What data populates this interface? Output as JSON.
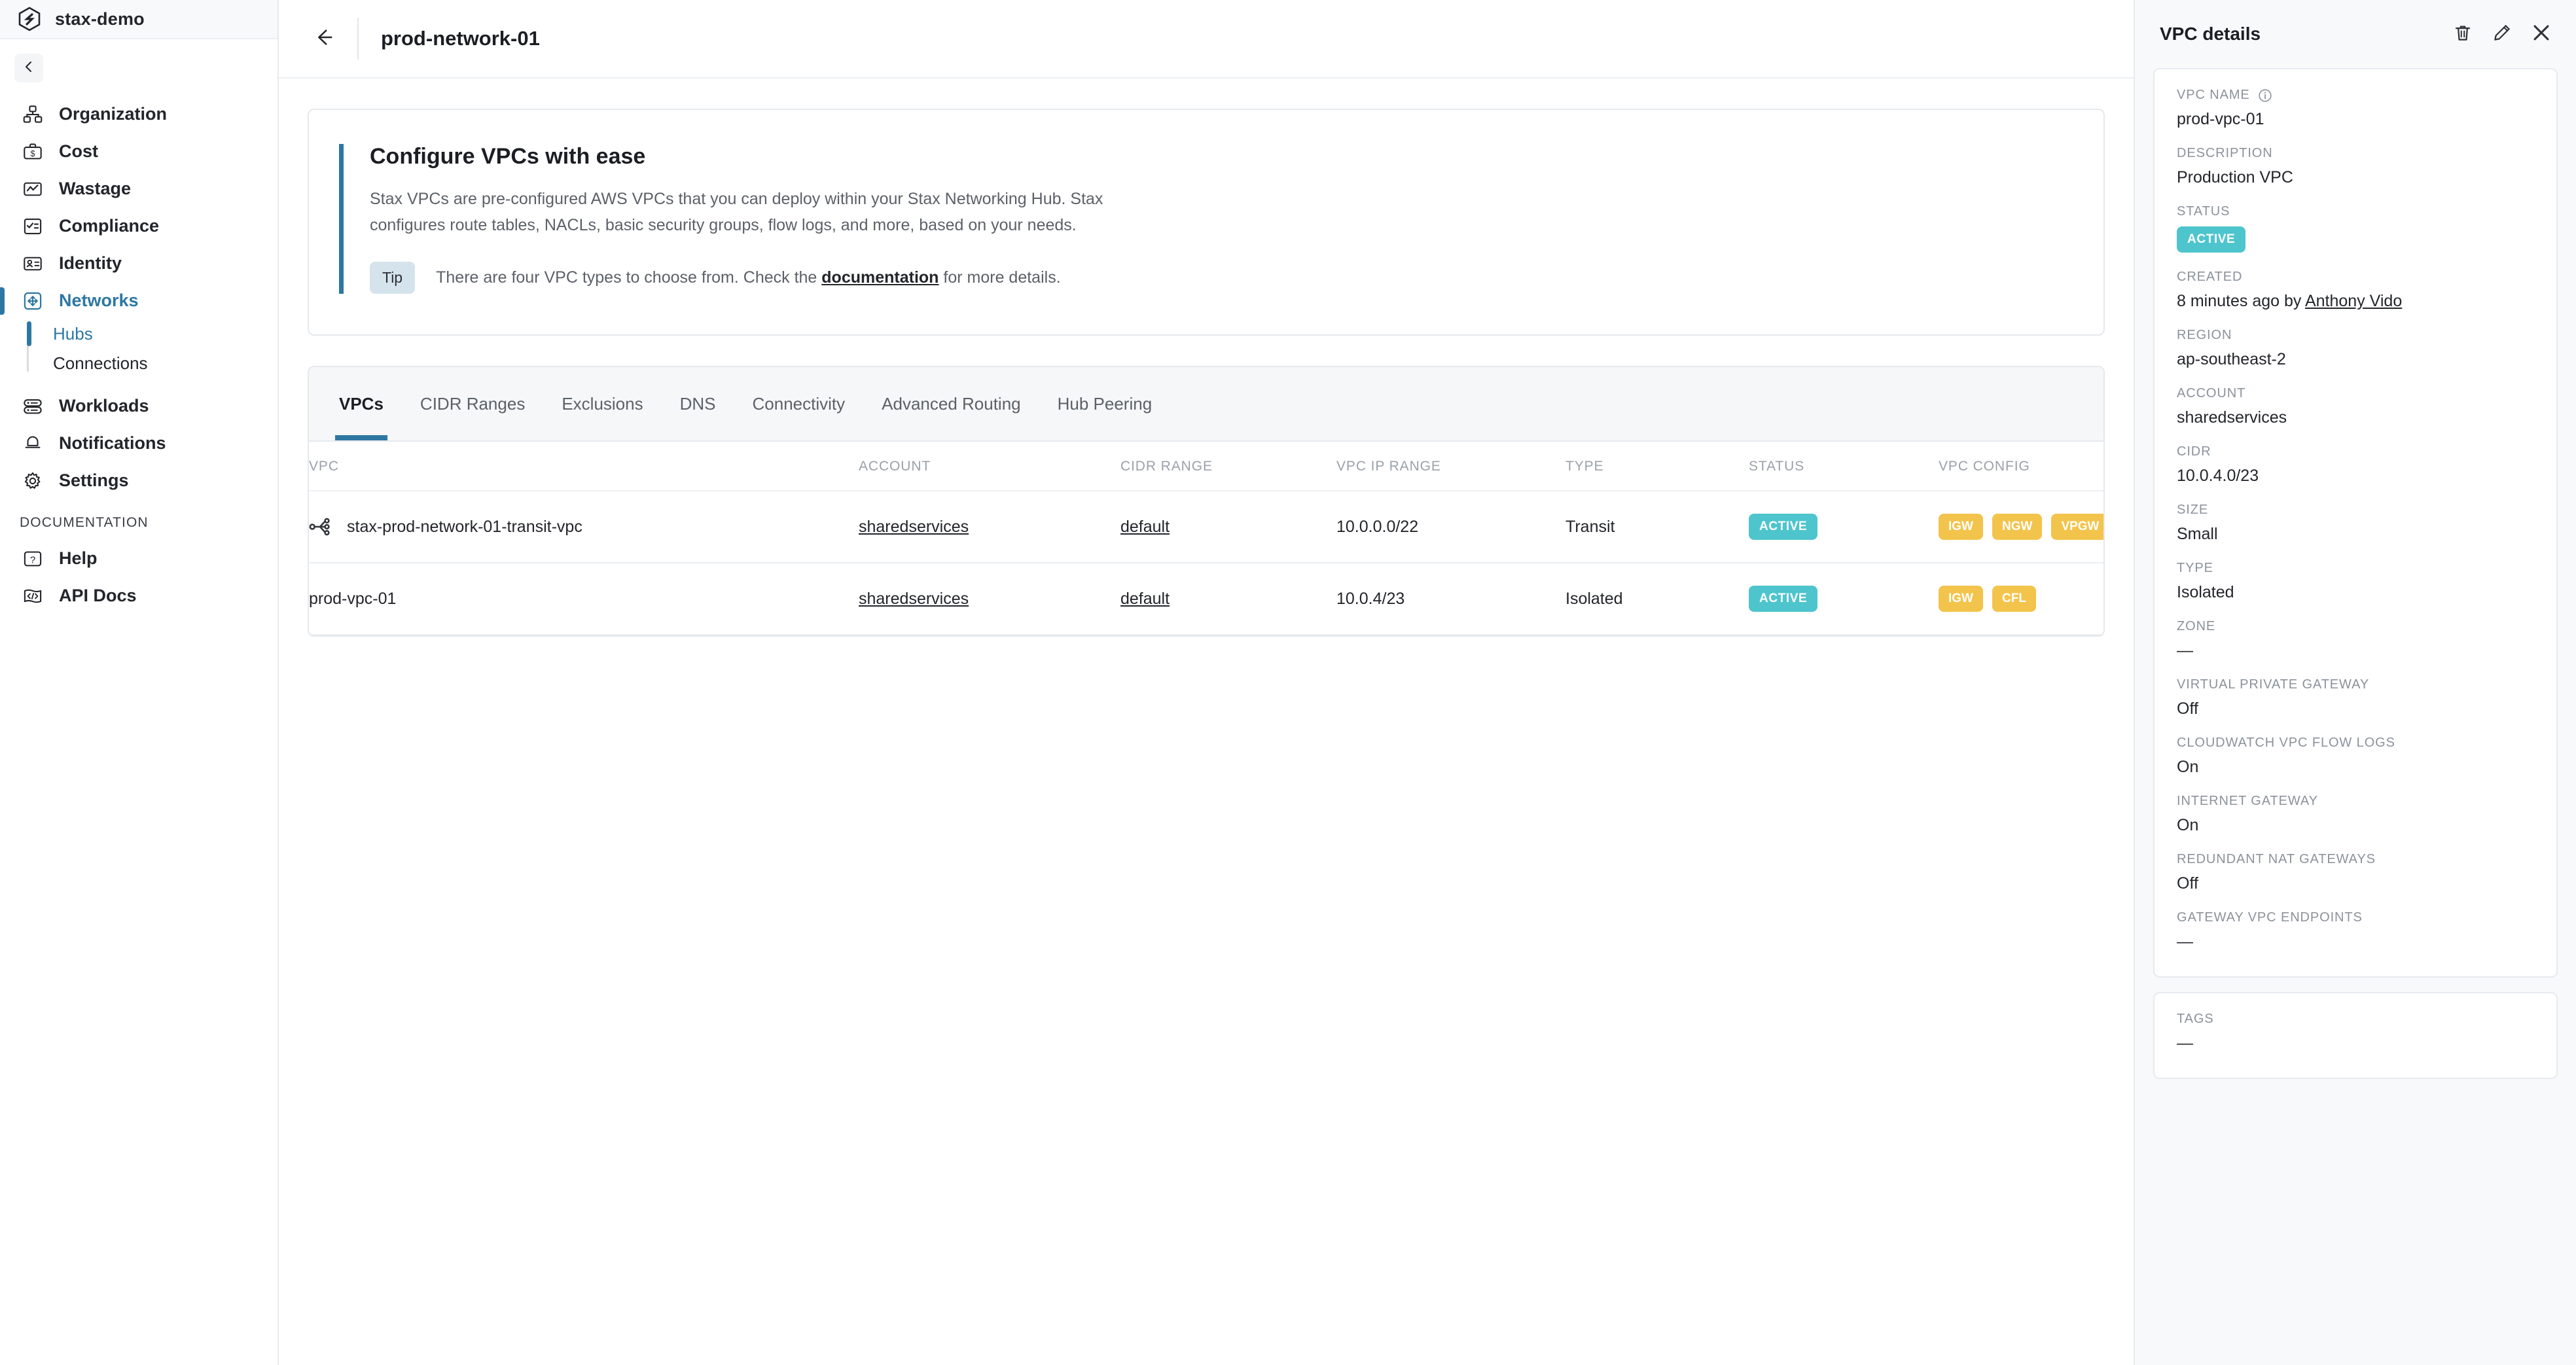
{
  "brand": {
    "name": "stax-demo",
    "logo_icon": "stax-hexagon-logo"
  },
  "sidebar": {
    "collapse_icon": "chevron-left-icon",
    "items": [
      {
        "label": "Organization",
        "icon": "org-chart-icon"
      },
      {
        "label": "Cost",
        "icon": "briefcase-dollar-icon"
      },
      {
        "label": "Wastage",
        "icon": "line-chart-icon"
      },
      {
        "label": "Compliance",
        "icon": "checklist-icon"
      },
      {
        "label": "Identity",
        "icon": "id-card-icon"
      },
      {
        "label": "Networks",
        "icon": "network-move-icon"
      }
    ],
    "subitems": [
      {
        "label": "Hubs"
      },
      {
        "label": "Connections"
      }
    ],
    "items_after": [
      {
        "label": "Workloads",
        "icon": "server-stack-icon"
      },
      {
        "label": "Notifications",
        "icon": "bell-icon"
      },
      {
        "label": "Settings",
        "icon": "gear-icon"
      }
    ],
    "section_label": "DOCUMENTATION",
    "doc_items": [
      {
        "label": "Help",
        "icon": "question-box-icon"
      },
      {
        "label": "API Docs",
        "icon": "code-brackets-icon"
      }
    ]
  },
  "header": {
    "back_icon": "arrow-left-icon",
    "title": "prod-network-01"
  },
  "banner": {
    "title": "Configure VPCs with ease",
    "body": "Stax VPCs are pre-configured AWS VPCs that you can deploy within your Stax Networking Hub. Stax configures route tables, NACLs, basic security groups, flow logs, and more, based on your needs.",
    "tip_badge": "Tip",
    "tip_before": "There are four VPC types to choose from. Check the ",
    "tip_link": "documentation",
    "tip_after": " for more details."
  },
  "tabs": [
    {
      "label": "VPCs",
      "active": true
    },
    {
      "label": "CIDR Ranges",
      "active": false
    },
    {
      "label": "Exclusions",
      "active": false
    },
    {
      "label": "DNS",
      "active": false
    },
    {
      "label": "Connectivity",
      "active": false
    },
    {
      "label": "Advanced Routing",
      "active": false
    },
    {
      "label": "Hub Peering",
      "active": false
    }
  ],
  "table": {
    "columns": [
      "VPC",
      "ACCOUNT",
      "CIDR RANGE",
      "VPC IP RANGE",
      "TYPE",
      "STATUS",
      "VPC CONFIG"
    ],
    "rows": [
      {
        "vpc": "stax-prod-network-01-transit-vpc",
        "vpc_icon": "network-share-icon",
        "account": "sharedservices",
        "cidr_range": "default",
        "ip_range": "10.0.0.0/22",
        "type": "Transit",
        "status": "ACTIVE",
        "config": [
          "IGW",
          "NGW",
          "VPGW"
        ]
      },
      {
        "vpc": "prod-vpc-01",
        "vpc_icon": "",
        "account": "sharedservices",
        "cidr_range": "default",
        "ip_range": "10.0.4/23",
        "type": "Isolated",
        "status": "ACTIVE",
        "config": [
          "IGW",
          "CFL"
        ]
      }
    ]
  },
  "details": {
    "title": "VPC details",
    "delete_icon": "trash-icon",
    "edit_icon": "pencil-icon",
    "close_icon": "close-icon",
    "fields": [
      {
        "label": "VPC NAME",
        "value": "prod-vpc-01",
        "info": true
      },
      {
        "label": "DESCRIPTION",
        "value": "Production VPC"
      },
      {
        "label": "STATUS",
        "value": "ACTIVE",
        "badge": true
      },
      {
        "label": "CREATED",
        "value_prefix": "8 minutes ago by ",
        "value_link": "Anthony Vido"
      },
      {
        "label": "REGION",
        "value": "ap-southeast-2"
      },
      {
        "label": "ACCOUNT",
        "value": "sharedservices"
      },
      {
        "label": "CIDR",
        "value": "10.0.4.0/23"
      },
      {
        "label": "SIZE",
        "value": "Small"
      },
      {
        "label": "TYPE",
        "value": "Isolated"
      },
      {
        "label": "ZONE",
        "value": "—"
      },
      {
        "label": "VIRTUAL PRIVATE GATEWAY",
        "value": "Off"
      },
      {
        "label": "CLOUDWATCH VPC FLOW LOGS",
        "value": "On"
      },
      {
        "label": "INTERNET GATEWAY",
        "value": "On"
      },
      {
        "label": "REDUNDANT NAT GATEWAYS",
        "value": "Off"
      },
      {
        "label": "GATEWAY VPC ENDPOINTS",
        "value": "—"
      }
    ],
    "tags": {
      "label": "TAGS",
      "value": "—"
    }
  },
  "colors": {
    "accent_blue": "#2e77a3",
    "status_teal": "#4ec5cd",
    "config_yellow": "#f3c44c",
    "tip_bg": "#d5e3ec"
  }
}
